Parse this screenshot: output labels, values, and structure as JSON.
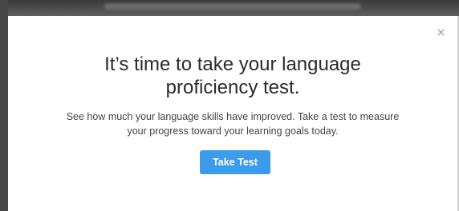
{
  "modal": {
    "close_icon": "close-icon",
    "headline_line1": "It’s time to take your language",
    "headline_line2": "proficiency test.",
    "description_line1": "See how much your language skills have improved. Take a test to measure",
    "description_line2": "your progress toward your learning goals today.",
    "take_test_label": "Take Test",
    "accent_color": "#3d9be9"
  }
}
